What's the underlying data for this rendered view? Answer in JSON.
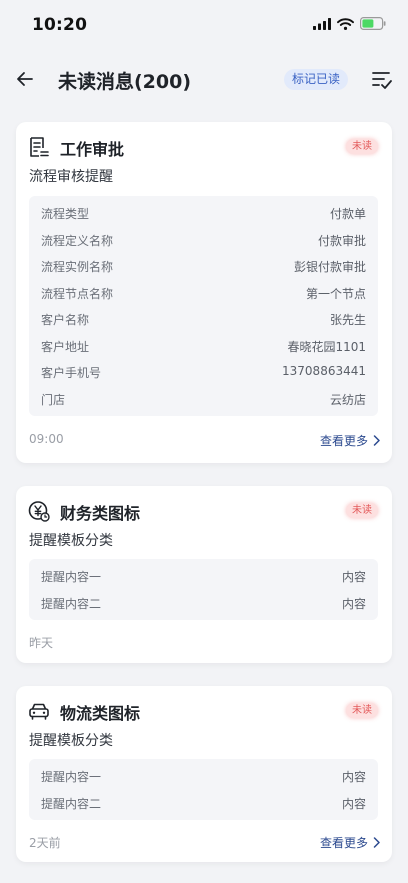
{
  "status_bar": {
    "time": "10:20",
    "icons": [
      "signal-icon",
      "wifi-icon",
      "battery-icon"
    ]
  },
  "header": {
    "title": "未读消息(200)",
    "mark_read_label": "标记已读",
    "back_icon": "arrow-left-icon",
    "filter_icon": "filter-list-icon"
  },
  "colors": {
    "accent": "#3b63c4",
    "badge_bg": "#fde0e0",
    "badge_text": "#e35a5a",
    "link": "#2c4a8f",
    "battery_fill": "#4cd964"
  },
  "cards": [
    {
      "icon": "document-list-icon",
      "title": "工作审批",
      "badge": "未读",
      "subtitle": "流程审核提醒",
      "rows": [
        {
          "key": "流程类型",
          "value": "付款单"
        },
        {
          "key": "流程定义名称",
          "value": "付款审批"
        },
        {
          "key": "流程实例名称",
          "value": "彭银付款审批"
        },
        {
          "key": "流程节点名称",
          "value": "第一个节点"
        },
        {
          "key": "客户名称",
          "value": "张先生"
        },
        {
          "key": "客户地址",
          "value": "春晓花园1101"
        },
        {
          "key": "客户手机号",
          "value": "13708863441"
        },
        {
          "key": "门店",
          "value": "云纺店"
        }
      ],
      "time": "09:00",
      "see_more": "查看更多"
    },
    {
      "icon": "yuan-coin-icon",
      "title": "财务类图标",
      "badge": "未读",
      "subtitle": "提醒模板分类",
      "rows": [
        {
          "key": "提醒内容一",
          "value": "内容"
        },
        {
          "key": "提醒内容二",
          "value": "内容"
        }
      ],
      "time": "昨天"
    },
    {
      "icon": "car-icon",
      "title": "物流类图标",
      "badge": "未读",
      "subtitle": "提醒模板分类",
      "rows": [
        {
          "key": "提醒内容一",
          "value": "内容"
        },
        {
          "key": "提醒内容二",
          "value": "内容"
        }
      ],
      "time": "2天前",
      "see_more": "查看更多"
    }
  ]
}
